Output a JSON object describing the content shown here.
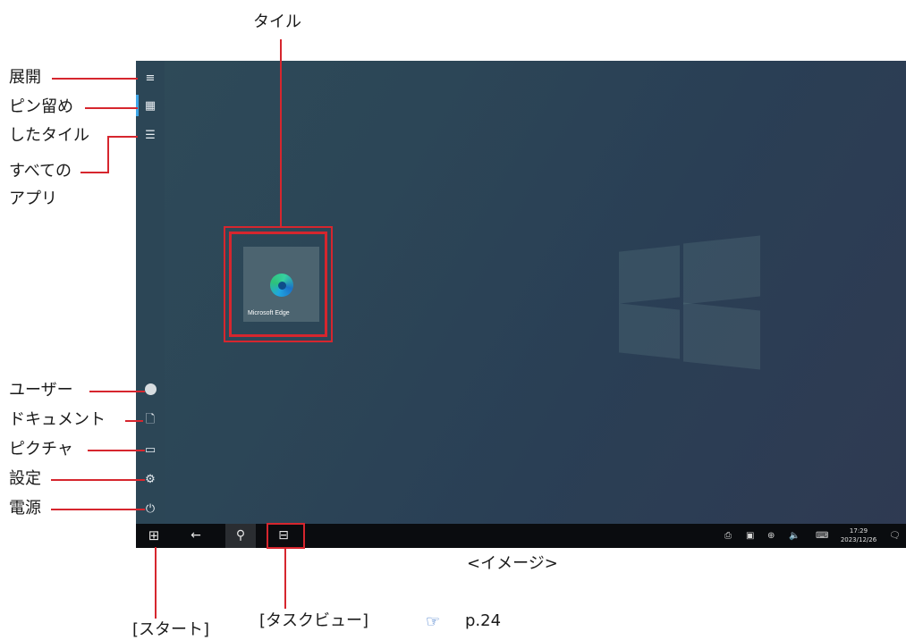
{
  "annotations": {
    "tile": "タイル",
    "expand": "展開",
    "pinned_line1": "ピン留め",
    "pinned_line2": "したタイル",
    "allapps_line1": "すべての",
    "allapps_line2": "アプリ",
    "user": "ユーザー",
    "documents": "ドキュメント",
    "pictures": "ピクチャ",
    "settings": "設定",
    "power": "電源",
    "image_caption": "<イメージ>",
    "taskview": "[タスクビュー]",
    "page_ref": "p.24",
    "start": "[スタート]"
  },
  "start_rail": {
    "icons": [
      "hamburger-icon",
      "pinned-tiles-icon",
      "all-apps-list-icon",
      "user-avatar-icon",
      "document-icon",
      "picture-icon",
      "gear-icon",
      "power-icon"
    ]
  },
  "tile": {
    "label": "Microsoft Edge",
    "icon": "edge-icon"
  },
  "taskbar": {
    "time": "17:29",
    "date": "2023/12/26",
    "icons": [
      "windows-start-icon",
      "back-arrow-icon",
      "search-icon",
      "task-view-icon",
      "tray-icons",
      "notification-icon"
    ]
  },
  "colors": {
    "annotation_red": "#d6262e",
    "accent_blue": "#3ea6e8",
    "taskbar": "#0a0c0f"
  }
}
